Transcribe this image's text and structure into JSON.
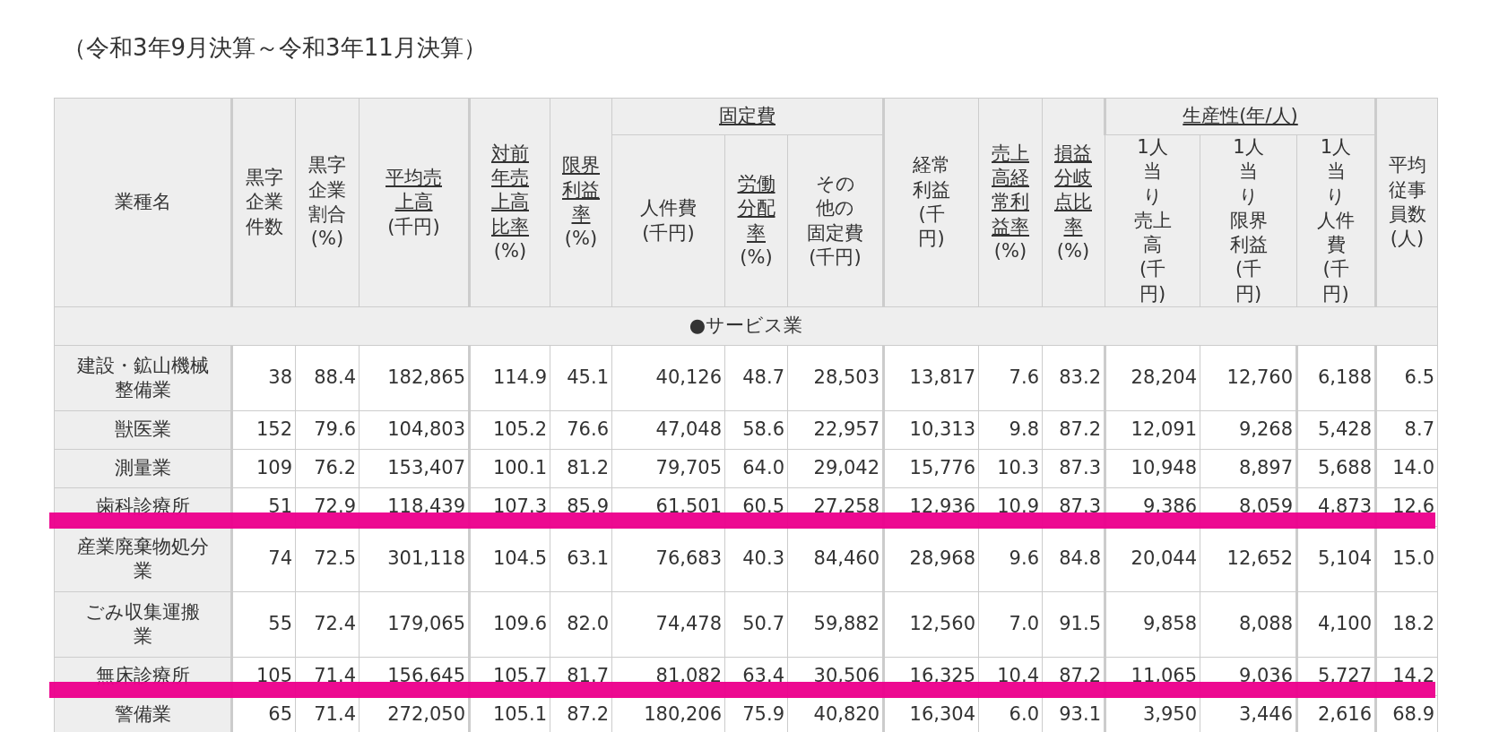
{
  "title": "（令和3年9月決算～令和3年11月決算）",
  "table": {
    "header_top": [
      {
        "text": "業種名"
      },
      {
        "text": "黒字企業件数"
      },
      {
        "text": "黒字企業割合(%)"
      },
      {
        "link": "平均売上高",
        "text": "(千円)"
      },
      {
        "link": "対前年売上高比率",
        "text": "(%)"
      },
      {
        "link": "限界利益率",
        "text": "(%)"
      },
      {
        "link": "固定費",
        "group": true
      },
      {
        "text": "経常利益(千円)"
      },
      {
        "link": "売上高経常利益率",
        "text": "(%)"
      },
      {
        "link": "損益分岐点比率",
        "text": "(%)"
      },
      {
        "link": "生産性(年/人)",
        "group": true
      },
      {
        "text": "平均従事員数(人)"
      }
    ],
    "header_sub": [
      {
        "text": "人件費(千円)"
      },
      {
        "link": "労働分配率",
        "text": "(%)"
      },
      {
        "text": "その他の固定費(千円)"
      },
      {
        "text": "1人当り売上高(千円)"
      },
      {
        "text": "1人当り限界利益(千円)"
      },
      {
        "text": "1人当り人件費(千円)"
      }
    ],
    "section": "●サービス業",
    "rows": [
      {
        "name": "建設・鉱山機械整備業",
        "highlighted": false,
        "values": [
          "38",
          "88.4",
          "182,865",
          "114.9",
          "45.1",
          "40,126",
          "48.7",
          "28,503",
          "13,817",
          "7.6",
          "83.2",
          "28,204",
          "12,760",
          "6,188",
          "6.5"
        ]
      },
      {
        "name": "獣医業",
        "highlighted": false,
        "values": [
          "152",
          "79.6",
          "104,803",
          "105.2",
          "76.6",
          "47,048",
          "58.6",
          "22,957",
          "10,313",
          "9.8",
          "87.2",
          "12,091",
          "9,268",
          "5,428",
          "8.7"
        ]
      },
      {
        "name": "測量業",
        "highlighted": false,
        "values": [
          "109",
          "76.2",
          "153,407",
          "100.1",
          "81.2",
          "79,705",
          "64.0",
          "29,042",
          "15,776",
          "10.3",
          "87.3",
          "10,948",
          "8,897",
          "5,688",
          "14.0"
        ]
      },
      {
        "name": "歯科診療所",
        "highlighted": true,
        "values": [
          "51",
          "72.9",
          "118,439",
          "107.3",
          "85.9",
          "61,501",
          "60.5",
          "27,258",
          "12,936",
          "10.9",
          "87.3",
          "9,386",
          "8,059",
          "4,873",
          "12.6"
        ]
      },
      {
        "name": "産業廃棄物処分業",
        "highlighted": false,
        "values": [
          "74",
          "72.5",
          "301,118",
          "104.5",
          "63.1",
          "76,683",
          "40.3",
          "84,460",
          "28,968",
          "9.6",
          "84.8",
          "20,044",
          "12,652",
          "5,104",
          "15.0"
        ]
      },
      {
        "name": "ごみ収集運搬業",
        "highlighted": false,
        "values": [
          "55",
          "72.4",
          "179,065",
          "109.6",
          "82.0",
          "74,478",
          "50.7",
          "59,882",
          "12,560",
          "7.0",
          "91.5",
          "9,858",
          "8,088",
          "4,100",
          "18.2"
        ]
      },
      {
        "name": "無床診療所",
        "highlighted": true,
        "values": [
          "105",
          "71.4",
          "156,645",
          "105.7",
          "81.7",
          "81,082",
          "63.4",
          "30,506",
          "16,325",
          "10.4",
          "87.2",
          "11,065",
          "9,036",
          "5,727",
          "14.2"
        ]
      },
      {
        "name": "警備業",
        "highlighted": false,
        "values": [
          "65",
          "71.4",
          "272,050",
          "105.1",
          "87.2",
          "180,206",
          "75.9",
          "40,820",
          "16,304",
          "6.0",
          "93.1",
          "3,950",
          "3,446",
          "2,616",
          "68.9"
        ]
      }
    ]
  }
}
